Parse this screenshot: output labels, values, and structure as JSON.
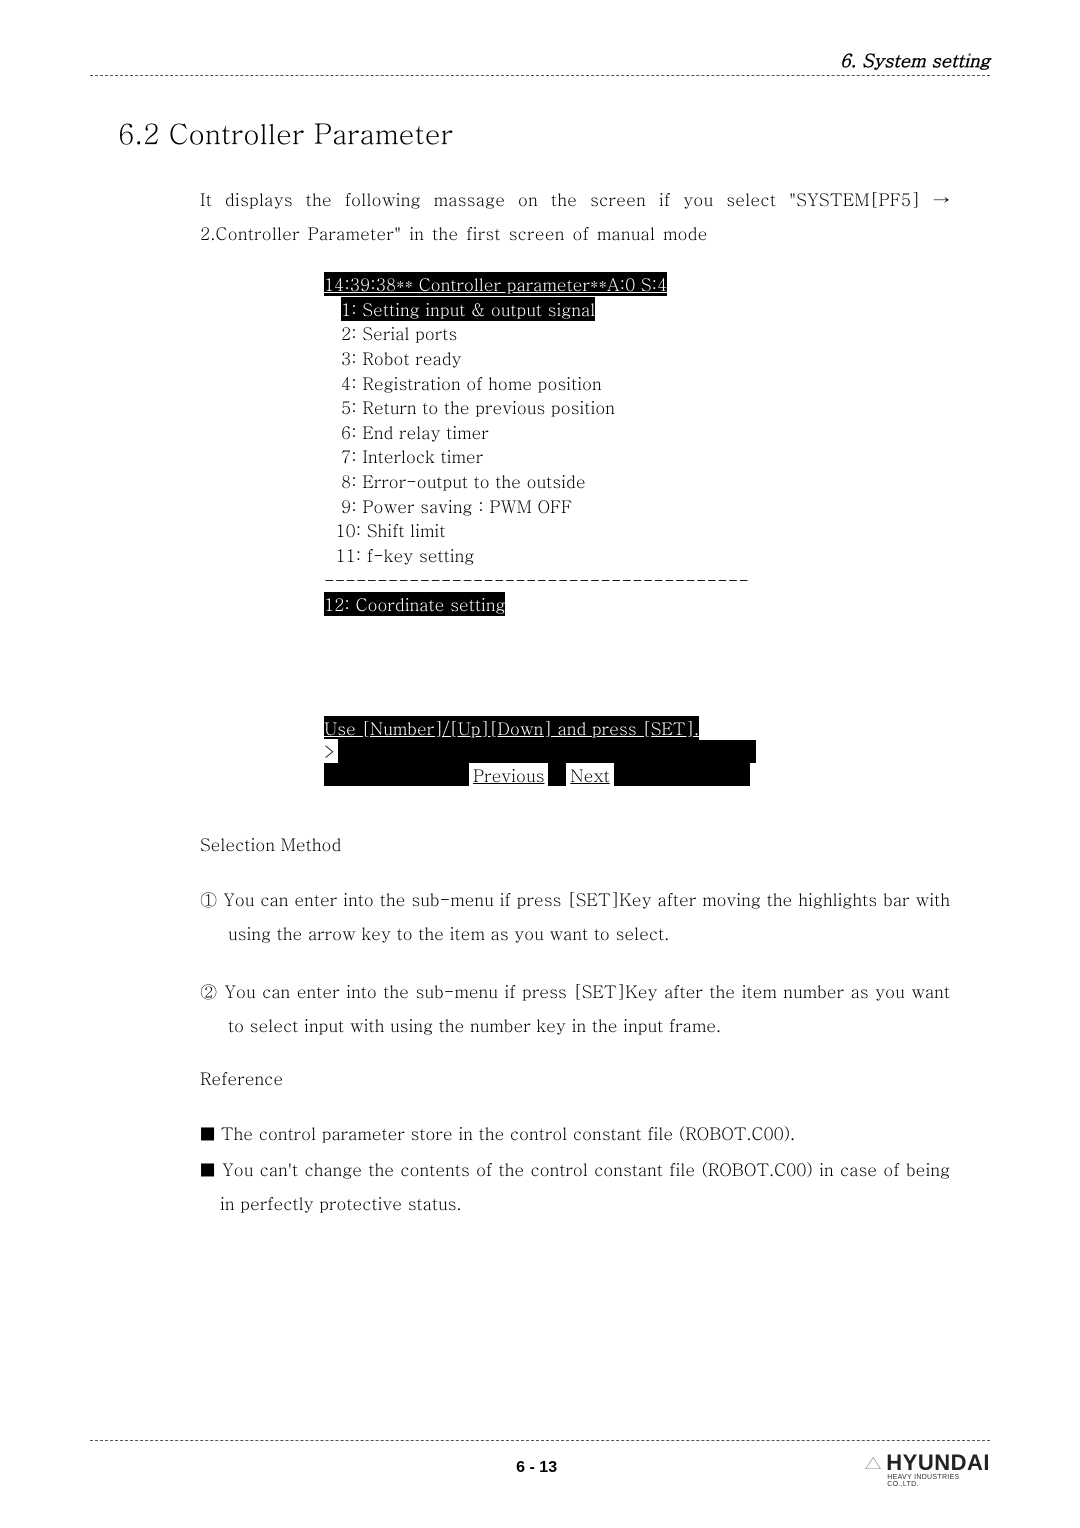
{
  "header": {
    "chapter": "6. System setting"
  },
  "section": {
    "title": "6.2 Controller Parameter",
    "intro": "It displays the following massage on the screen if you select \"SYSTEM[PF5] → 2.Controller Parameter\" in the first screen of manual mode"
  },
  "terminal": {
    "title": "14:39:38** Controller parameter**A:0 S:4",
    "items": [
      {
        "num": " 1:",
        "text": " Setting input & output signal",
        "highlight": true
      },
      {
        "num": " 2:",
        "text": " Serial ports",
        "highlight": false
      },
      {
        "num": " 3:",
        "text": " Robot ready",
        "highlight": false
      },
      {
        "num": " 4:",
        "text": " Registration of home position",
        "highlight": false
      },
      {
        "num": " 5:",
        "text": " Return to the previous position",
        "highlight": false
      },
      {
        "num": " 6:",
        "text": " End relay timer",
        "highlight": false
      },
      {
        "num": " 7:",
        "text": " Interlock timer",
        "highlight": false
      },
      {
        "num": " 8:",
        "text": " Error-output to the outside",
        "highlight": false
      },
      {
        "num": " 9:",
        "text": " Power saving : PWM OFF",
        "highlight": false
      },
      {
        "num": "10:",
        "text": " Shift limit",
        "highlight": false
      },
      {
        "num": "11:",
        "text": " f-key setting",
        "highlight": false
      }
    ],
    "divider": "----------------------------------------",
    "item12": "12: Coordinate setting",
    "instruction": "Use [Number]/[Up][Down] and press [SET].",
    "prompt": ">",
    "prev": "Previous",
    "next": "Next"
  },
  "selection": {
    "heading": "Selection Method",
    "items": [
      "① You can enter into the sub-menu if press [SET]Key after moving the highlights bar with using the arrow key to the item as you want to select.",
      "② You can enter into the sub-menu if press [SET]Key after the item number as you want to select input with using the number key in the input frame."
    ]
  },
  "reference": {
    "heading": "Reference",
    "items": [
      "■ The control parameter store in the control constant file (ROBOT.C00).",
      "■ You can't change the contents of the control constant file (ROBOT.C00) in case of being in perfectly protective status."
    ]
  },
  "footer": {
    "page": "6 - 13",
    "logo": "HYUNDAI",
    "logo_sub": "HEAVY INDUSTRIES CO.,LTD."
  }
}
